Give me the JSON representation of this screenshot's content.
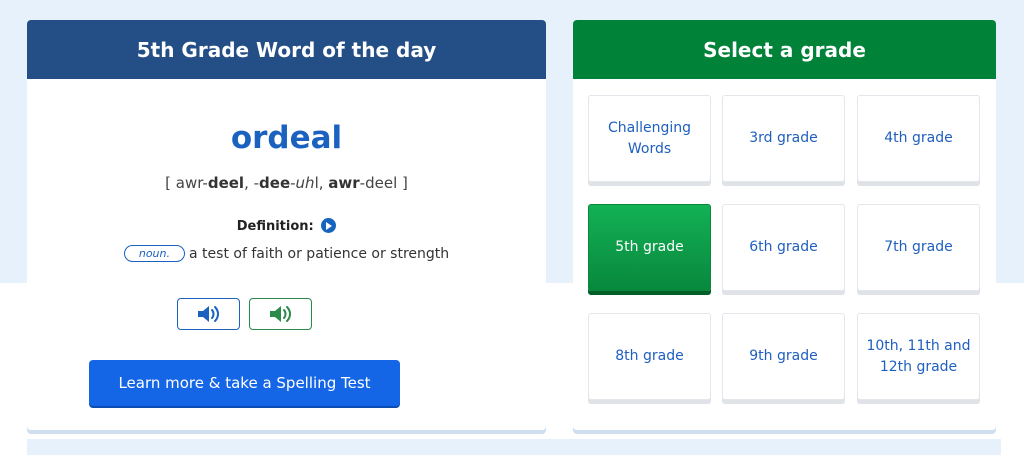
{
  "word_card": {
    "header": "5th Grade Word of the day",
    "word": "ordeal",
    "pron_open": "[ ",
    "pron_p1": "awr-",
    "pron_p2": "deel",
    "pron_p3": ", -",
    "pron_p4": "dee",
    "pron_p5": "-",
    "pron_p6": "uh",
    "pron_p7": "l, ",
    "pron_p8": "awr",
    "pron_p9": "-deel",
    "pron_close": " ]",
    "definition_label": "Definition:",
    "part_of_speech": "noun.",
    "definition": "a test of faith or patience or strength",
    "cta_label": "Learn more & take a Spelling Test",
    "colors": {
      "header": "#244f86",
      "word": "#1b62c0",
      "cta": "#1566e6"
    }
  },
  "grade_card": {
    "header": "Select a grade",
    "selected": "5th grade",
    "grades": [
      "Challenging Words",
      "3rd grade",
      "4th grade",
      "5th grade",
      "6th grade",
      "7th grade",
      "8th grade",
      "9th grade",
      "10th, 11th and 12th grade"
    ],
    "colors": {
      "header": "#008239",
      "selected": "#0a9a45",
      "link": "#1f5fbf"
    }
  }
}
